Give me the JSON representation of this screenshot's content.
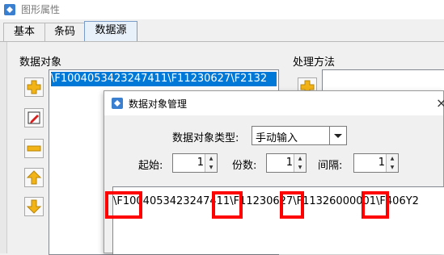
{
  "window": {
    "title": "图形属性"
  },
  "tabs": [
    {
      "label": "基本",
      "active": false
    },
    {
      "label": "条码",
      "active": false
    },
    {
      "label": "数据源",
      "active": true
    }
  ],
  "data_object": {
    "group_label": "数据对象",
    "selected_item": "\\F1004053423247411\\F11230627\\F2132"
  },
  "processing": {
    "group_label": "处理方法"
  },
  "dialog": {
    "title": "数据对象管理",
    "close_glyph": "×",
    "type_label": "数据对象类型:",
    "type_value": "手动输入",
    "start_label": "起始:",
    "start_value": "1",
    "copies_label": "份数:",
    "copies_value": "1",
    "interval_label": "间隔:",
    "interval_value": "1",
    "text_value": "\\F1004053423247411\\F11230627\\F11326000001\\F406Y2"
  },
  "colors": {
    "selection": "#0078d7",
    "highlight": "#ff0000",
    "add_button": "#f2b316",
    "tab_active": "#e8f1fa"
  },
  "icons": [
    "app-icon",
    "add-icon",
    "edit-icon",
    "remove-icon",
    "move-up-icon",
    "move-down-icon",
    "dropdown-arrow-icon"
  ]
}
